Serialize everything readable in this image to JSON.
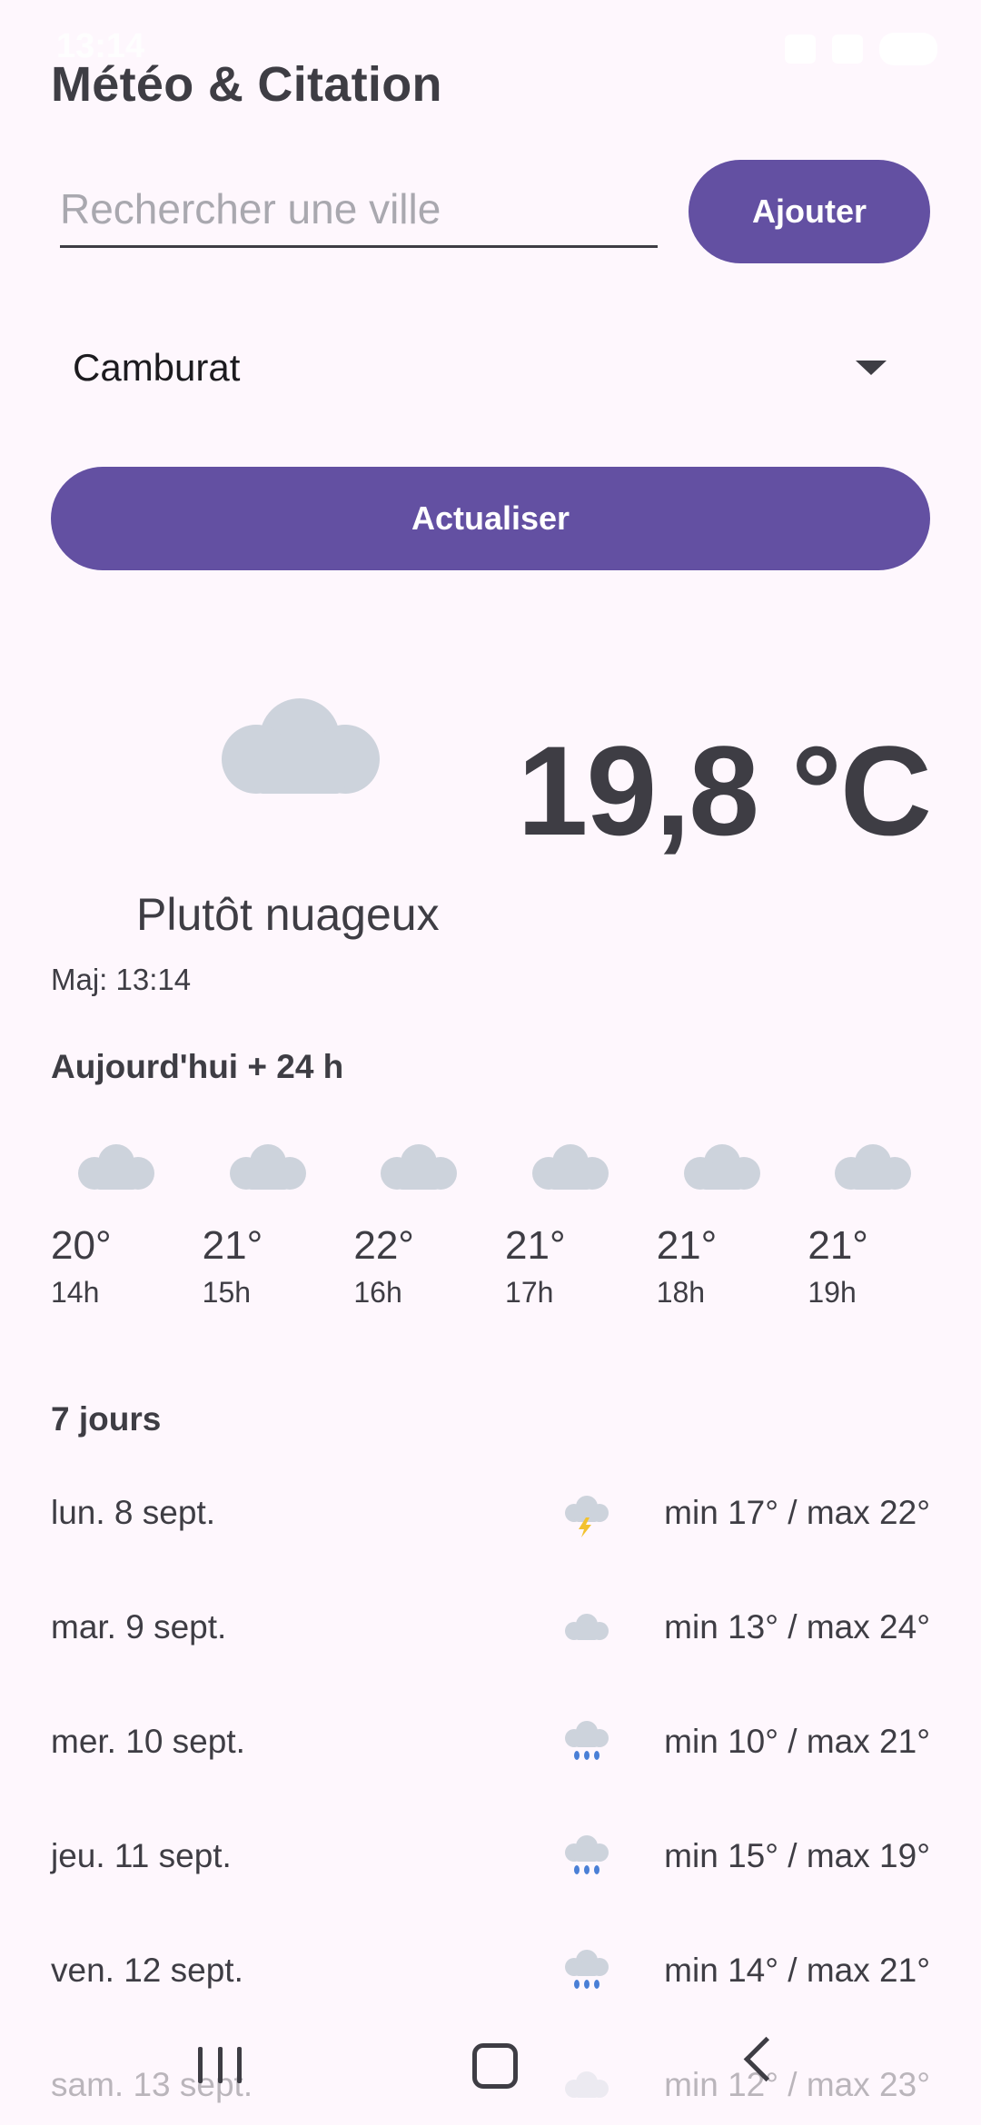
{
  "status_bar": {
    "time": "13:14"
  },
  "header": {
    "title": "Météo & Citation"
  },
  "search": {
    "placeholder": "Rechercher une ville",
    "value": "",
    "add_label": "Ajouter"
  },
  "city_select": {
    "selected": "Camburat"
  },
  "refresh_label": "Actualiser",
  "current": {
    "temperature": "19,8 °C",
    "condition": "Plutôt nuageux",
    "updated": "Maj: 13:14",
    "icon": "cloud-icon"
  },
  "hourly": {
    "title": "Aujourd'hui + 24 h",
    "items": [
      {
        "temp": "20°",
        "hour": "14h",
        "icon": "cloud-icon"
      },
      {
        "temp": "21°",
        "hour": "15h",
        "icon": "cloud-icon"
      },
      {
        "temp": "22°",
        "hour": "16h",
        "icon": "cloud-icon"
      },
      {
        "temp": "21°",
        "hour": "17h",
        "icon": "cloud-icon"
      },
      {
        "temp": "21°",
        "hour": "18h",
        "icon": "cloud-icon"
      },
      {
        "temp": "21°",
        "hour": "19h",
        "icon": "cloud-icon"
      }
    ]
  },
  "daily": {
    "title": "7 jours",
    "items": [
      {
        "day": "lun. 8 sept.",
        "range": "min 17° / max 22°",
        "icon": "thunderstorm-icon"
      },
      {
        "day": "mar. 9 sept.",
        "range": "min 13° / max 24°",
        "icon": "cloud-icon"
      },
      {
        "day": "mer. 10 sept.",
        "range": "min 10° / max 21°",
        "icon": "rain-icon"
      },
      {
        "day": "jeu. 11 sept.",
        "range": "min 15° / max 19°",
        "icon": "rain-icon"
      },
      {
        "day": "ven. 12 sept.",
        "range": "min 14° / max 21°",
        "icon": "rain-icon"
      },
      {
        "day": "sam. 13 sept.",
        "range": "min 12° / max 23°",
        "icon": "cloud-icon"
      }
    ]
  },
  "colors": {
    "primary": "#6350A2",
    "background": "#FEF7FD",
    "text": "#3E3D44",
    "cloud": "#CDD3DC",
    "rain": "#4A7FD6",
    "bolt": "#F2C230"
  }
}
